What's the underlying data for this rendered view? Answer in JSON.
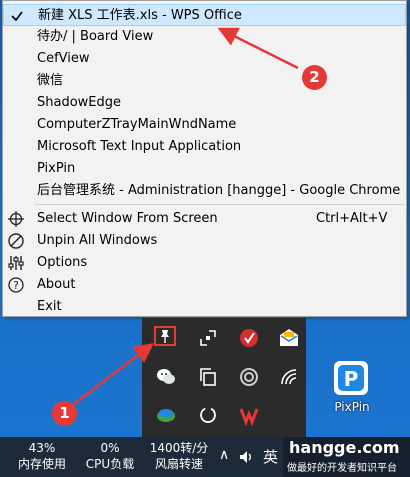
{
  "menu": {
    "windows": [
      {
        "label": "新建 XLS 工作表.xls - WPS Office",
        "checked": true
      },
      {
        "label": "待办/ | Board View"
      },
      {
        "label": "CefView"
      },
      {
        "label": "微信"
      },
      {
        "label": "ShadowEdge"
      },
      {
        "label": "ComputerZTrayMainWndName"
      },
      {
        "label": "Microsoft Text Input Application"
      },
      {
        "label": "PixPin"
      },
      {
        "label": "后台管理系统 - Administration [hangge] - Google Chrome"
      }
    ],
    "actions": [
      {
        "label": "Select Window From Screen",
        "shortcut": "Ctrl+Alt+V",
        "icon": "crosshair-icon"
      },
      {
        "label": "Unpin All Windows",
        "icon": "no-entry-icon"
      },
      {
        "label": "Options",
        "icon": "sliders-icon"
      },
      {
        "label": "About",
        "icon": "question-icon"
      },
      {
        "label": "Exit"
      }
    ]
  },
  "annotations": {
    "one": "1",
    "two": "2",
    "color": "#e53935"
  },
  "desktop": {
    "pixpin_label": "PixPin"
  },
  "taskbar": {
    "memory": {
      "value": "43%",
      "label": "内存使用"
    },
    "cpu": {
      "value": "0%",
      "label": "CPU负载"
    },
    "fan": {
      "value": "1400转/分",
      "label": "风扇转速"
    },
    "ime": "英",
    "chevron": "∧",
    "brand_title": "hangge.com",
    "brand_sub": "做最好的开发者知识平台"
  }
}
